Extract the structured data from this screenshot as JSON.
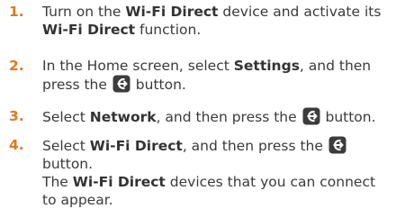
{
  "steps": [
    {
      "number": "1.",
      "lines": [
        [
          "Turn on the ",
          {
            "b": "Wi-Fi Direct"
          },
          " device and activate its"
        ],
        [
          {
            "b": "Wi-Fi Direct"
          },
          " function."
        ]
      ]
    },
    {
      "number": "2.",
      "lines": [
        [
          "In the Home screen, select ",
          {
            "b": "Settings"
          },
          ", and then"
        ],
        [
          "press the ",
          {
            "icon": "enter-icon"
          },
          " button."
        ]
      ]
    },
    {
      "number": "3.",
      "lines": [
        [
          "Select ",
          {
            "b": "Network"
          },
          ", and then press the ",
          {
            "icon": "enter-icon"
          },
          " button."
        ]
      ]
    },
    {
      "number": "4.",
      "lines": [
        [
          "Select ",
          {
            "b": "Wi-Fi Direct"
          },
          ", and then press the ",
          {
            "icon": "enter-icon"
          }
        ],
        [
          "button."
        ],
        [
          "The ",
          {
            "b": "Wi-Fi Direct"
          },
          " devices that you can connect"
        ],
        [
          "to appear."
        ]
      ]
    }
  ],
  "colors": {
    "step_number": "#e0791f",
    "text": "#3a3a3a",
    "icon_fill": "#3c3c3c"
  }
}
